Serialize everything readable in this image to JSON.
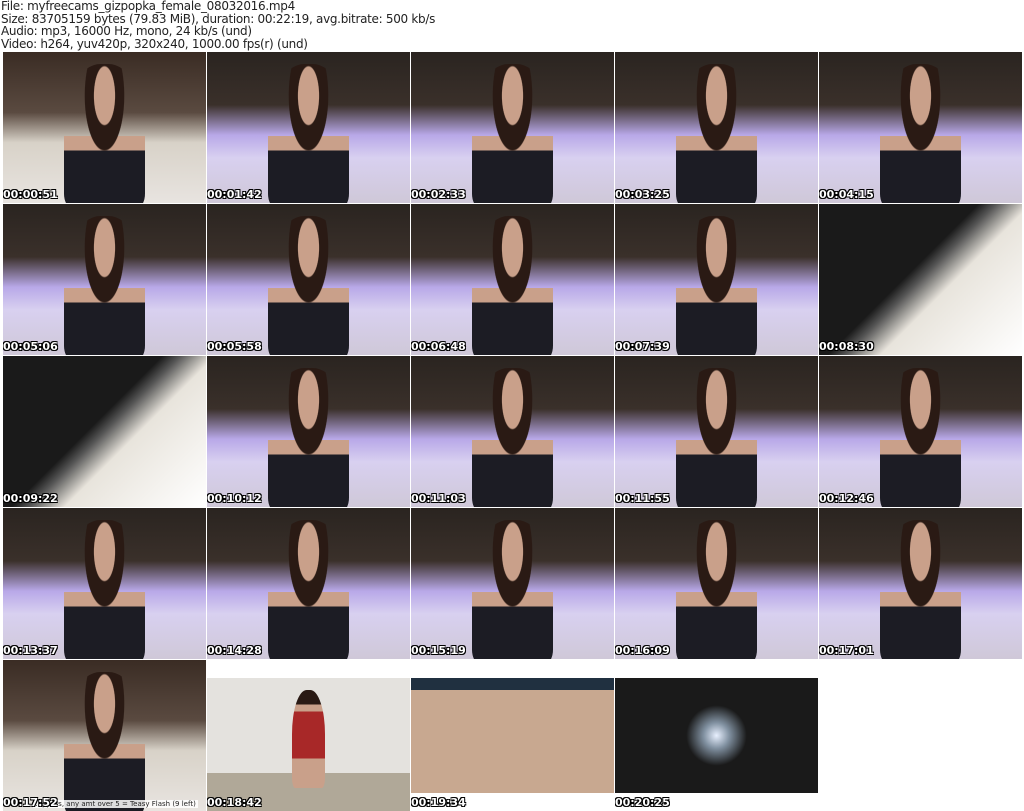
{
  "header": {
    "file": "File: myfreecams_gizpopka_female_08032016.mp4",
    "size": "Size: 83705159 bytes (79.83 MiB), duration: 00:22:19, avg.bitrate: 500 kb/s",
    "audio": "Audio: mp3, 16000 Hz, mono, 24 kb/s (und)",
    "video": "Video: h264, yuv420p, 320x240, 1000.00 fps(r) (und)"
  },
  "thumbs": [
    {
      "t": "00:00:51",
      "k": "cam"
    },
    {
      "t": "00:01:42",
      "k": ""
    },
    {
      "t": "00:02:33",
      "k": ""
    },
    {
      "t": "00:03:25",
      "k": ""
    },
    {
      "t": "00:04:15",
      "k": ""
    },
    {
      "t": "00:05:06",
      "k": ""
    },
    {
      "t": "00:05:58",
      "k": ""
    },
    {
      "t": "00:06:48",
      "k": ""
    },
    {
      "t": "00:07:39",
      "k": ""
    },
    {
      "t": "00:08:30",
      "k": "alt"
    },
    {
      "t": "00:09:22",
      "k": "alt"
    },
    {
      "t": "00:10:12",
      "k": ""
    },
    {
      "t": "00:11:03",
      "k": ""
    },
    {
      "t": "00:11:55",
      "k": ""
    },
    {
      "t": "00:12:46",
      "k": ""
    },
    {
      "t": "00:13:37",
      "k": ""
    },
    {
      "t": "00:14:28",
      "k": ""
    },
    {
      "t": "00:15:19",
      "k": ""
    },
    {
      "t": "00:16:09",
      "k": ""
    },
    {
      "t": "00:17:01",
      "k": ""
    },
    {
      "t": "00:17:52",
      "k": "cam",
      "caption": "...ppers, any amt over 5 = Teasy Flash (9 left)"
    },
    {
      "t": "00:18:42",
      "k": "room"
    },
    {
      "t": "00:19:34",
      "k": "legs"
    },
    {
      "t": "00:20:25",
      "k": "dark"
    }
  ]
}
